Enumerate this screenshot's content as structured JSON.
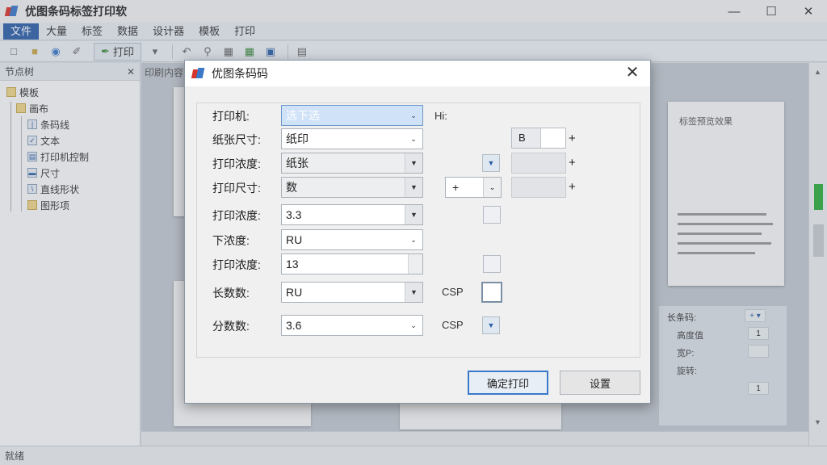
{
  "app": {
    "title": "优图条码标签打印软",
    "window_controls": [
      "—",
      "☐",
      "✕"
    ]
  },
  "menubar": {
    "items": [
      "文件",
      "大量",
      "标签",
      "数据",
      "设计器",
      "模板",
      "打印"
    ]
  },
  "toolbar": {
    "print_label": "打印"
  },
  "left_panel": {
    "title": "节点树",
    "close": "✕",
    "tree": [
      {
        "label": "模板",
        "icon": "folder-icon"
      },
      {
        "label": "画布",
        "icon": "folder-icon"
      },
      {
        "label": "条码线",
        "icon": "barcode-icon"
      },
      {
        "label": "文本",
        "icon": "checkbox-icon"
      },
      {
        "label": "打印机控制",
        "icon": "printer-icon"
      },
      {
        "label": "尺寸",
        "icon": "ruler-icon"
      },
      {
        "label": "直线形状",
        "icon": "line-icon"
      },
      {
        "label": "图形项",
        "icon": "shape-icon"
      }
    ]
  },
  "workarea": {
    "tab": "印刷内容",
    "preview_title": "标签预览效果",
    "props": {
      "title": "长条码:",
      "rows": [
        "高度值",
        "宽P:",
        "旋转:"
      ],
      "values": [
        "1",
        "",
        "1"
      ]
    }
  },
  "statusbar": {
    "text": "就绪"
  },
  "dialog": {
    "title": "优图条码码",
    "close": "✕",
    "fields": [
      {
        "label": "打印机:",
        "value": "选下选",
        "selected": true
      },
      {
        "label": "纸张尺寸:",
        "value": "纸印"
      },
      {
        "label": "打印浓度:",
        "value": "纸张"
      },
      {
        "label": "打印尺寸:",
        "value": "数"
      },
      {
        "label": "打印浓度:",
        "value": "3.3"
      },
      {
        "label": "下浓度:",
        "value": "RU"
      },
      {
        "label": "打印浓度:",
        "value": "13"
      },
      {
        "label": "长数数:",
        "value": "RU"
      },
      {
        "label": "分数数:",
        "value": "3.6"
      }
    ],
    "hint_unit": "Hi:",
    "size_b": "B",
    "combo_plus": "+",
    "plus_sign": "+",
    "sp_unit_1": "CSP",
    "sp_unit_2": "CSP",
    "buttons": {
      "ok": "确定打印",
      "cancel": "设置"
    }
  }
}
